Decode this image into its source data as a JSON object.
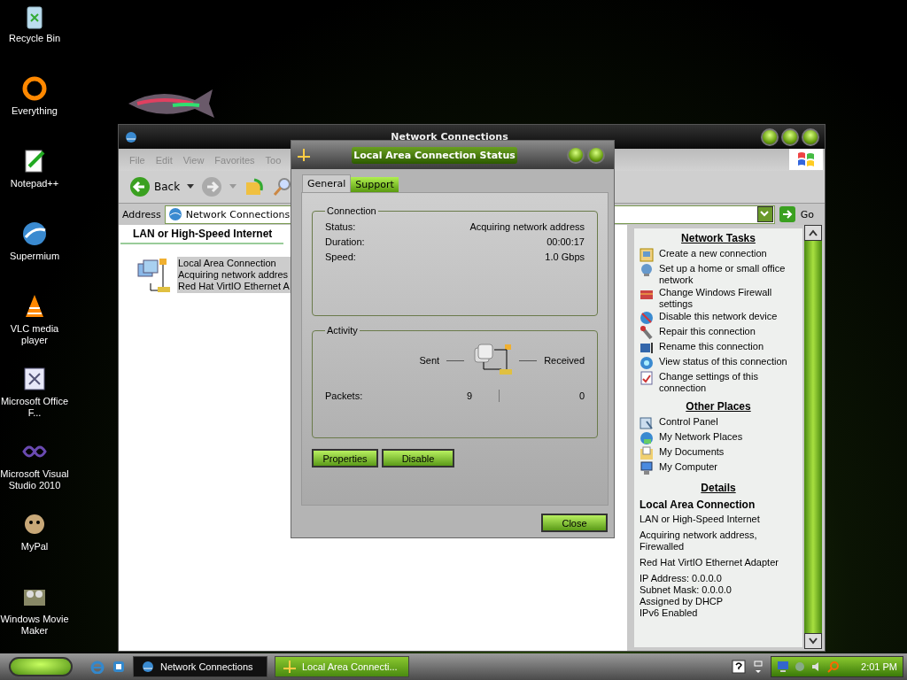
{
  "desktop_icons": [
    {
      "label": "Recycle Bin"
    },
    {
      "label": "Everything"
    },
    {
      "label": "Notepad++"
    },
    {
      "label": "Supermium"
    },
    {
      "label": "VLC media player"
    },
    {
      "label": "Microsoft Office F..."
    },
    {
      "label": "Microsoft Visual Studio 2010"
    },
    {
      "label": "MyPal"
    },
    {
      "label": "Windows Movie Maker"
    }
  ],
  "explorer": {
    "title": "Network Connections",
    "menu": [
      {
        "label": "File"
      },
      {
        "label": "Edit"
      },
      {
        "label": "View"
      },
      {
        "label": "Favorites"
      },
      {
        "label": "Too"
      }
    ],
    "back": "Back",
    "address": {
      "label": "Address",
      "value": "Network Connections"
    },
    "go": "Go",
    "group_heading": "LAN or High-Speed Internet",
    "connection": {
      "selected": true,
      "lines": [
        "Local Area Connection",
        "Acquiring network addres",
        "Red Hat VirtIO Ethernet A"
      ]
    },
    "task_sections": [
      {
        "heading": "Network Tasks",
        "items": [
          "Create a new connection",
          "Set up a home or small office network",
          "Change Windows Firewall settings",
          "Disable this network device",
          "Repair this connection",
          "Rename this connection",
          "View status of this connection",
          "Change settings of this connection"
        ]
      },
      {
        "heading": "Other Places",
        "items": [
          "Control Panel",
          "My Network Places",
          "My Documents",
          "My Computer"
        ]
      }
    ],
    "details": {
      "heading": "Details",
      "name": "Local Area Connection",
      "blocks": [
        [
          "LAN or High-Speed Internet"
        ],
        [
          "Acquiring network address, Firewalled"
        ],
        [
          "Red Hat VirtIO Ethernet Adapter"
        ],
        [
          "IP Address: 0.0.0.0",
          "Subnet Mask: 0.0.0.0",
          "Assigned by DHCP",
          "IPv6 Enabled"
        ]
      ]
    }
  },
  "dialog": {
    "title": "Local Area Connection Status",
    "tabs": [
      {
        "label": "General",
        "selected": true
      },
      {
        "label": "Support",
        "selected": false
      }
    ],
    "connection": {
      "legend": "Connection",
      "rows": [
        {
          "label": "Status:",
          "value": "Acquiring network address"
        },
        {
          "label": "Duration:",
          "value": "00:00:17"
        },
        {
          "label": "Speed:",
          "value": "1.0 Gbps"
        }
      ]
    },
    "activity": {
      "legend": "Activity",
      "sent_label": "Sent",
      "received_label": "Received",
      "packets_label": "Packets:",
      "sent": "9",
      "received": "0"
    },
    "buttons": [
      "Properties",
      "Disable"
    ],
    "close": "Close"
  },
  "taskbar": {
    "tasks": [
      {
        "label": "Network Connections",
        "selected": false
      },
      {
        "label": "Local Area Connecti...",
        "selected": true
      }
    ],
    "clock": "2:01 PM"
  }
}
